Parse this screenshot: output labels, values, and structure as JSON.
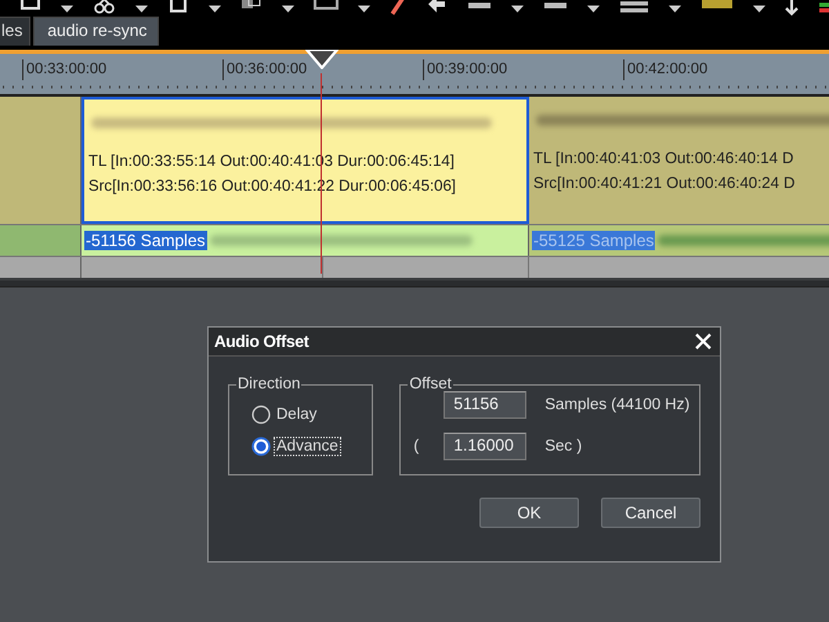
{
  "tabs": [
    {
      "label": "les",
      "selected": false
    },
    {
      "label": "audio re-sync",
      "selected": true
    }
  ],
  "ruler": {
    "labels": [
      "00:33:00:00",
      "00:36:00:00",
      "00:39:00:00",
      "00:42:00:00"
    ]
  },
  "video_clips": [
    {
      "selected": true,
      "timeline": "TL [In:00:33:55:14 Out:00:40:41:03 Dur:00:06:45:14]",
      "source": "Src[In:00:33:56:16 Out:00:40:41:22 Dur:00:06:45:06]"
    },
    {
      "selected": false,
      "timeline": "TL [In:00:40:41:03 Out:00:46:40:14 D",
      "source": "Src[In:00:40:41:21 Out:00:46:40:24 D"
    }
  ],
  "audio_clips": [
    {
      "selected": true,
      "label": "-51156 Samples"
    },
    {
      "selected": false,
      "label": "-55125 Samples"
    }
  ],
  "dialog": {
    "title": "Audio Offset",
    "direction": {
      "title": "Direction",
      "options": [
        {
          "label": "Delay",
          "selected": false
        },
        {
          "label": "Advance",
          "selected": true
        }
      ]
    },
    "offset": {
      "title": "Offset",
      "samples": "51156",
      "samples_unit": "Samples (44100 Hz)",
      "open_paren": "(",
      "seconds": "1.16000",
      "seconds_unit": "Sec )"
    },
    "buttons": [
      "OK",
      "Cancel"
    ]
  }
}
